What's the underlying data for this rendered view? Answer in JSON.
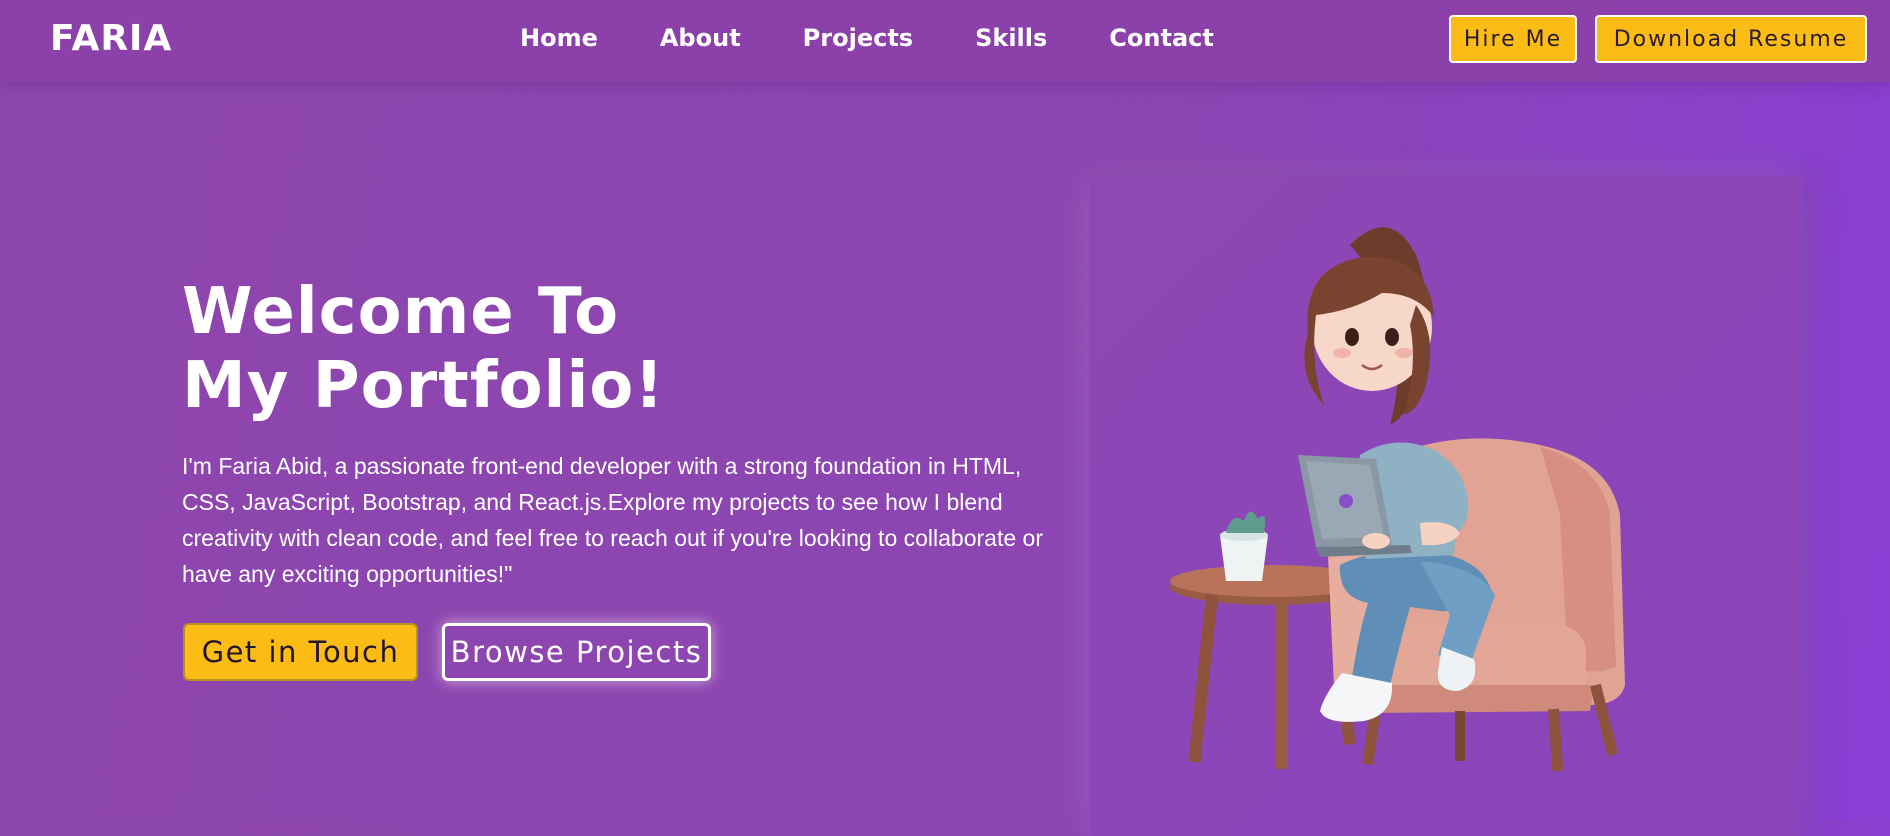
{
  "nav": {
    "logo": "FARIA",
    "items": [
      {
        "label": "Home"
      },
      {
        "label": "About"
      },
      {
        "label": "Projects"
      },
      {
        "label": "Skills"
      },
      {
        "label": "Contact"
      }
    ],
    "hire_label": "Hire Me",
    "resume_label": "Download Resume"
  },
  "hero": {
    "title_line1": "Welcome To",
    "title_line2": "My Portfolio!",
    "description": "I'm Faria Abid, a passionate front-end developer with a strong foundation in HTML, CSS, JavaScript, Bootstrap, and React.js.Explore my projects to see how I blend creativity with clean code, and feel free to reach out if you're looking to collaborate or have any exciting opportunities!\"",
    "cta_primary": "Get in Touch",
    "cta_secondary": "Browse Projects"
  },
  "colors": {
    "accent": "#fbbd15",
    "background": "#8e47ad",
    "text": "#ffffff"
  },
  "illustration": {
    "icon": "developer-girl-on-armchair-with-laptop-illustration"
  }
}
